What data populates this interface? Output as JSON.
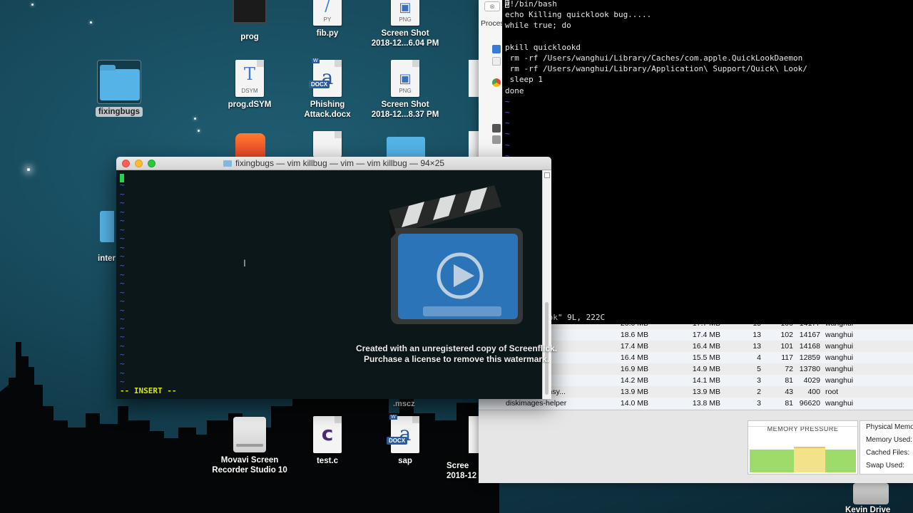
{
  "desktop": {
    "icons": [
      {
        "label": "prog",
        "kind": "exec"
      },
      {
        "label": "fib.py",
        "kind": "py",
        "badge": "PY"
      },
      {
        "label": "Screen Shot\n2018-12...6.04 PM",
        "kind": "png",
        "badge": "PNG"
      },
      {
        "label": "fixingbugs",
        "kind": "folder"
      },
      {
        "label": "prog.dSYM",
        "kind": "dsym",
        "badge": "DSYM"
      },
      {
        "label": "Phishing\nAttack.docx",
        "kind": "docx",
        "badge": "DOCX"
      },
      {
        "label": "Screen Shot\n2018-12...8.37 PM",
        "kind": "png",
        "badge": "PNG"
      },
      {
        "label": "inter",
        "kind": "folder"
      },
      {
        "label": ".mscz",
        "kind": "file"
      },
      {
        "label": "Movavi Screen\nRecorder Studio 10",
        "kind": "drive"
      },
      {
        "label": "test.c",
        "kind": "c",
        "badge": "c"
      },
      {
        "label": "sap",
        "kind": "docx",
        "badge": "DOCX"
      },
      {
        "label": "Scree\n2018-12",
        "kind": "png"
      },
      {
        "label": "Kevin Drive",
        "kind": "drive"
      }
    ]
  },
  "vim_window": {
    "title": "fixingbugs — vim killbug — vim — vim killbug — 94×25",
    "mode_line": "-- INSERT --",
    "tilde": "~"
  },
  "killbug_terminal": {
    "lines": [
      "#!/bin/bash",
      "echo Killing quicklook bug.....",
      "while true; do",
      "",
      "pkill quicklookd",
      " rm -rf /Users/wanghui/Library/Caches/com.apple.QuickLookDaemon",
      " rm -rf /Users/wanghui/Library/Application\\ Support/Quick\\ Look/",
      " sleep 1",
      "done"
    ],
    "tilde": "~",
    "status_line": "ook\" 9L, 222C"
  },
  "activity_monitor": {
    "tab_fragment": "Proces",
    "rows": [
      {
        "name": "Helper",
        "mem": "20.0 MB",
        "real": "17.7 MB",
        "threads": "15",
        "ports": "100",
        "pid": "14177",
        "user": "wanghui"
      },
      {
        "name": "e Helper",
        "mem": "18.6 MB",
        "real": "17.4 MB",
        "threads": "13",
        "ports": "102",
        "pid": "14167",
        "user": "wanghui"
      },
      {
        "name": "e Helper",
        "mem": "17.4 MB",
        "real": "16.4 MB",
        "threads": "13",
        "ports": "101",
        "pid": "14168",
        "user": "wanghui"
      },
      {
        "name": "",
        "mem": "16.4 MB",
        "real": "15.5 MB",
        "threads": "4",
        "ports": "117",
        "pid": "12859",
        "user": "wanghui"
      },
      {
        "name": "",
        "mem": "16.9 MB",
        "real": "14.9 MB",
        "threads": "5",
        "ports": "72",
        "pid": "13780",
        "user": "wanghui"
      },
      {
        "name": "elper",
        "mem": "14.2 MB",
        "real": "14.1 MB",
        "threads": "3",
        "ports": "81",
        "pid": "4029",
        "user": "wanghui"
      },
      {
        "name": "peech.speechsy...",
        "mem": "13.9 MB",
        "real": "13.9 MB",
        "threads": "2",
        "ports": "43",
        "pid": "400",
        "user": "root"
      },
      {
        "name": "diskimages-helper",
        "mem": "14.0 MB",
        "real": "13.8 MB",
        "threads": "3",
        "ports": "81",
        "pid": "96620",
        "user": "wanghui"
      }
    ],
    "memory_pressure_title": "MEMORY PRESSURE",
    "stats": [
      "Physical Memo",
      "Memory Used:",
      "Cached Files:",
      "Swap Used:"
    ]
  },
  "watermark": {
    "line1": "Created with an unregistered copy of Screenflick.",
    "line2": "Purchase a license to remove this watermark."
  },
  "colors": {
    "vim_insert": "#d6e900",
    "vim_cursor": "#27d34b",
    "vim_tilde": "#4a5cff",
    "memory_green": "#9ddc6b",
    "memory_yellow": "#f2e38a"
  }
}
